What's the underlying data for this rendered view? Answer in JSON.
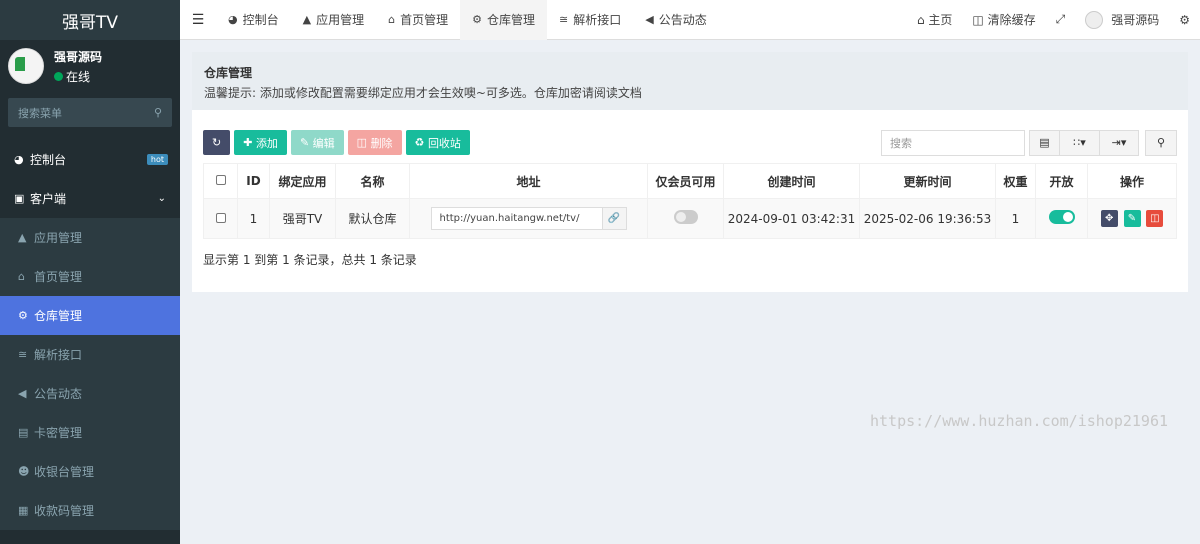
{
  "sidebar": {
    "logo": "强哥TV",
    "user_name": "强哥源码",
    "user_status": "在线",
    "search_placeholder": "搜索菜单",
    "items": [
      {
        "label": "控制台",
        "icon": "dashboard-icon",
        "badge": "hot"
      },
      {
        "label": "客户端",
        "icon": "desktop-icon"
      },
      {
        "label": "应用管理",
        "icon": "android-icon"
      },
      {
        "label": "首页管理",
        "icon": "home-icon"
      },
      {
        "label": "仓库管理",
        "icon": "cogs-icon"
      },
      {
        "label": "解析接口",
        "icon": "usb-icon"
      },
      {
        "label": "公告动态",
        "icon": "bullhorn-icon"
      },
      {
        "label": "卡密管理",
        "icon": "card-icon"
      },
      {
        "label": "收银台管理",
        "icon": "user-plus-icon"
      },
      {
        "label": "收款码管理",
        "icon": "qrcode-icon"
      }
    ]
  },
  "topbar": {
    "tabs": [
      {
        "label": "控制台",
        "icon": "dashboard-icon"
      },
      {
        "label": "应用管理",
        "icon": "android-icon"
      },
      {
        "label": "首页管理",
        "icon": "home-icon"
      },
      {
        "label": "仓库管理",
        "icon": "cogs-icon"
      },
      {
        "label": "解析接口",
        "icon": "usb-icon"
      },
      {
        "label": "公告动态",
        "icon": "bullhorn-icon"
      }
    ],
    "home": "主页",
    "clear_cache": "清除缓存",
    "user": "强哥源码"
  },
  "panel": {
    "title": "仓库管理",
    "tip": "温馨提示: 添加或修改配置需要绑定应用才会生效噢~可多选。仓库加密请阅读文档"
  },
  "toolbar": {
    "add": "添加",
    "edit": "编辑",
    "delete": "删除",
    "recycle": "回收站",
    "search_placeholder": "搜索"
  },
  "table": {
    "headers": [
      "ID",
      "绑定应用",
      "名称",
      "地址",
      "仅会员可用",
      "创建时间",
      "更新时间",
      "权重",
      "开放",
      "操作"
    ],
    "rows": [
      {
        "id": "1",
        "app": "强哥TV",
        "name": "默认仓库",
        "url": "http://yuan.haitangw.net/tv/",
        "vip_only": false,
        "created": "2024-09-01 03:42:31",
        "updated": "2025-02-06 19:36:53",
        "weight": "1",
        "open": true
      }
    ]
  },
  "pagination": "显示第 1 到第 1 条记录，总共 1 条记录",
  "watermark": "https://www.huzhan.com/ishop21961",
  "colors": {
    "sidebar_bg": "#222d32",
    "active_menu": "#4e73df",
    "green": "#18bc9c",
    "dark_btn": "#444c69",
    "red": "#e74c3c"
  }
}
